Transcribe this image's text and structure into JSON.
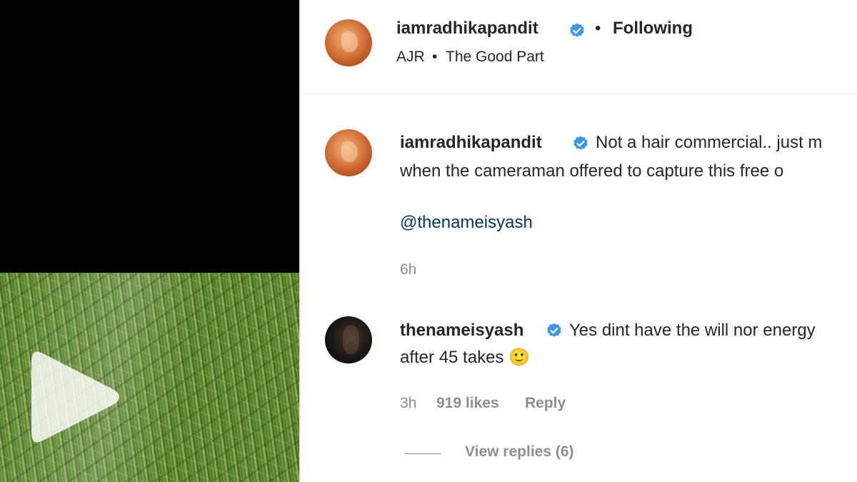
{
  "header": {
    "username": "iamradhikapandit",
    "separator": "•",
    "follow_status": "Following",
    "audio_artist": "AJR",
    "audio_separator": "•",
    "audio_title": "The Good Part"
  },
  "caption": {
    "username": "iamradhikapandit",
    "line1": "Not a hair commercial.. just m",
    "line2": "when the cameraman offered to capture this free o",
    "mention": "@thenameisyash",
    "time": "6h"
  },
  "comments": [
    {
      "username": "thenameisyash",
      "line1": "Yes dint have the will nor energy",
      "line2": "after 45 takes 🙂",
      "time": "3h",
      "likes": "919 likes",
      "reply_label": "Reply",
      "view_replies": "View replies (6)"
    }
  ],
  "icons": {
    "verified": "verified-badge-icon",
    "play": "play-icon"
  },
  "colors": {
    "verified_blue": "#3897f0",
    "mention_blue": "#00376b",
    "secondary_text": "#8e8e8e"
  }
}
